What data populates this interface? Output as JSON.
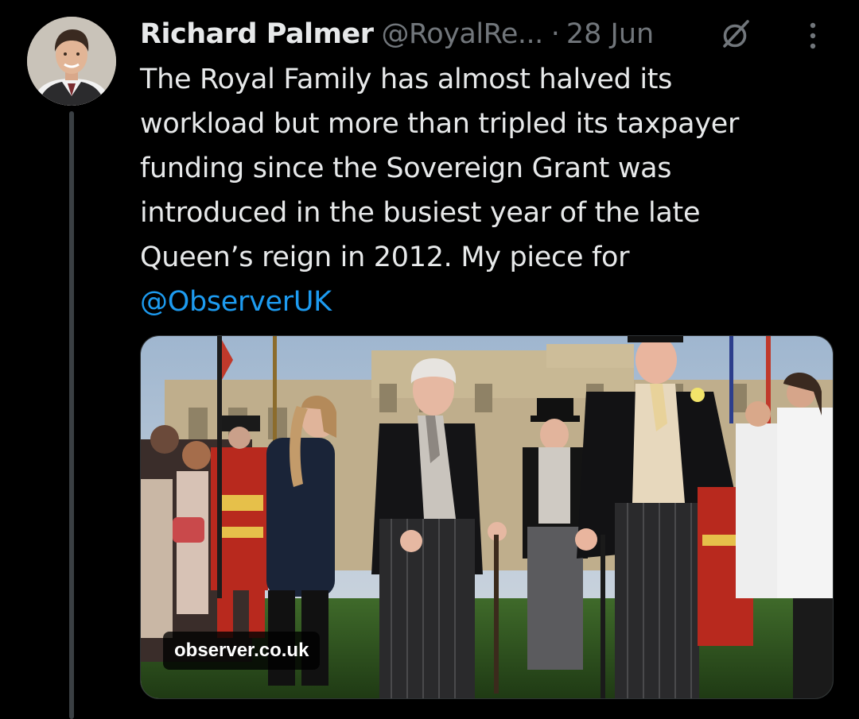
{
  "tweet": {
    "author": {
      "name": "Richard Palmer",
      "handle": "@RoyalRe...",
      "avatar_icon": "profile-photo"
    },
    "separator": "·",
    "date": "28 Jun",
    "grok_icon": "grok-icon",
    "more_icon": "more-vertical-icon",
    "text_lines": [
      "The Royal Family has almost halved its",
      "workload but more than tripled its taxpayer",
      "funding since the Sovereign Grant was",
      "introduced in the busiest year of the late",
      "Queen’s reign in 2012. My piece for"
    ],
    "mention": "@ObserverUK",
    "card": {
      "domain": "observer.co.uk"
    }
  },
  "colors": {
    "background": "#000000",
    "text": "#e7e9ea",
    "muted": "#71767b",
    "link": "#1d9bf0",
    "thread_line": "#3a3f43"
  }
}
